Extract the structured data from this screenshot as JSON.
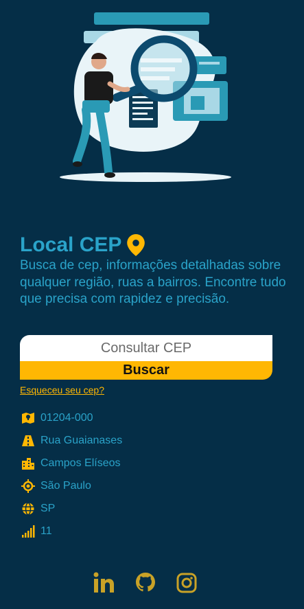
{
  "colors": {
    "background": "#052e47",
    "accent": "#ffb703",
    "text": "#2aa3c9",
    "illustration_blue": "#2a9ab5"
  },
  "app": {
    "title": "Local CEP",
    "title_icon": "location-pin-icon",
    "description": "Busca de cep, informações detalhadas sobre qualquer região, ruas a bairros. Encontre tudo que precisa com rapidez e precisão."
  },
  "search": {
    "placeholder": "Consultar CEP",
    "button_label": "Buscar",
    "forgot_link": "Esqueceu seu cep?"
  },
  "results": [
    {
      "icon": "map-icon",
      "value": "01204-000"
    },
    {
      "icon": "road-icon",
      "value": "Rua Guaianases"
    },
    {
      "icon": "city-icon",
      "value": "Campos Elíseos"
    },
    {
      "icon": "crosshair-icon",
      "value": "São Paulo"
    },
    {
      "icon": "globe-icon",
      "value": "SP"
    },
    {
      "icon": "signal-icon",
      "value": "11"
    }
  ],
  "social": [
    {
      "icon": "linkedin-icon"
    },
    {
      "icon": "github-icon"
    },
    {
      "icon": "instagram-icon"
    }
  ]
}
